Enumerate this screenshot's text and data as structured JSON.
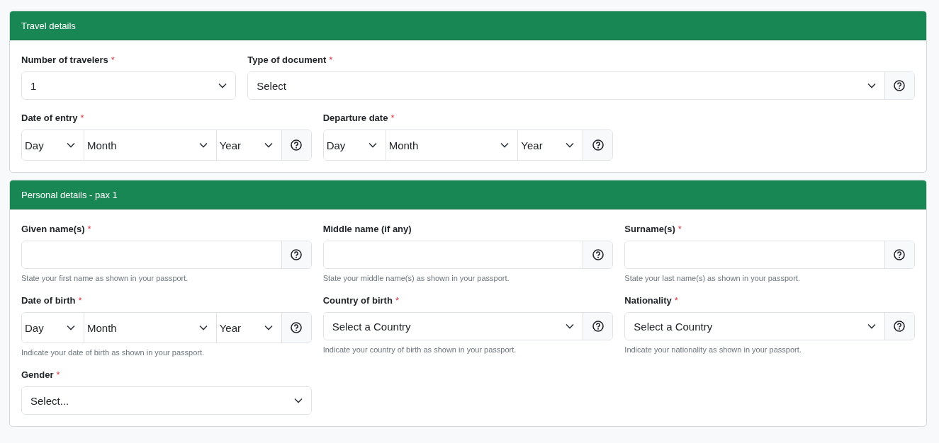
{
  "sections": [
    {
      "title": "Travel details",
      "rows": [
        [
          {
            "kind": "select",
            "label": "Number of travelers",
            "required_mark": "*",
            "value": "1"
          },
          {
            "kind": "select",
            "label": "Type of document",
            "required_mark": "*",
            "value": "Select",
            "help": true
          }
        ],
        [
          {
            "kind": "date",
            "label": "Date of entry",
            "required_mark": "*",
            "parts": [
              "Day",
              "Month",
              "Year"
            ],
            "help": true
          },
          {
            "kind": "date",
            "label": "Departure date",
            "required_mark": "*",
            "parts": [
              "Day",
              "Month",
              "Year"
            ],
            "help": true
          }
        ]
      ]
    },
    {
      "title": "Personal details - pax 1",
      "rows": [
        [
          {
            "kind": "text",
            "label": "Given name(s)",
            "required_mark": "*",
            "help": true,
            "hint": "State your first name as shown in your passport."
          },
          {
            "kind": "text",
            "label": "Middle name (if any)",
            "help": true,
            "hint": "State your middle name(s) as shown in your passport."
          },
          {
            "kind": "text",
            "label": "Surname(s)",
            "required_mark": "*",
            "help": true,
            "hint": "State your last name(s) as shown in your passport."
          }
        ],
        [
          {
            "kind": "date",
            "label": "Date of birth",
            "required_mark": "*",
            "parts": [
              "Day",
              "Month",
              "Year"
            ],
            "help": true,
            "hint": "Indicate your date of birth as shown in your passport."
          },
          {
            "kind": "select",
            "label": "Country of birth",
            "required_mark": "*",
            "value": "Select a Country",
            "help": true,
            "hint": "Indicate your country of birth as shown in your passport."
          },
          {
            "kind": "select",
            "label": "Nationality",
            "required_mark": "*",
            "value": "Select a Country",
            "help": true,
            "hint": "Indicate your nationality as shown in your passport."
          }
        ],
        [
          {
            "kind": "select",
            "label": "Gender",
            "required_mark": "*",
            "value": "Select..."
          }
        ]
      ]
    }
  ]
}
